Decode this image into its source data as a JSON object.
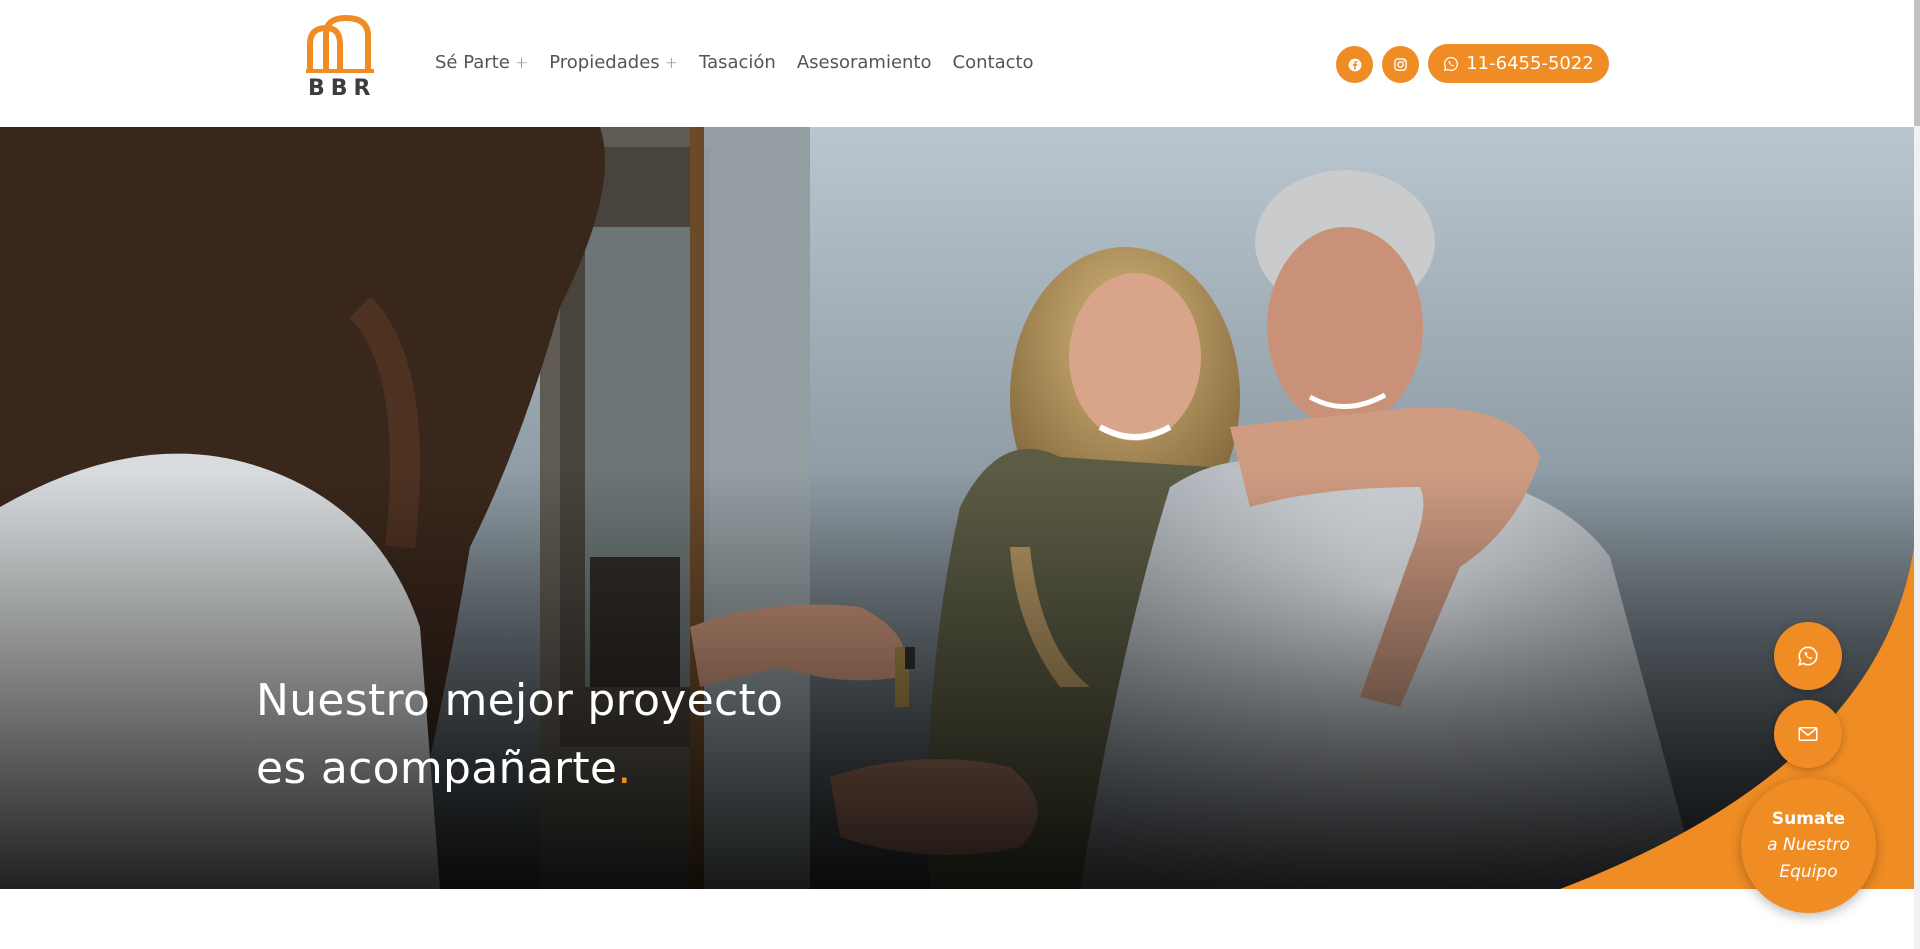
{
  "brand": {
    "name": "BBR",
    "accent_color": "#f08c24",
    "logo_icon": "arch-logo-icon"
  },
  "nav": {
    "items": [
      {
        "label": "Sé Parte",
        "has_submenu": true,
        "submenu_icon": "plus-icon"
      },
      {
        "label": "Propiedades",
        "has_submenu": true,
        "submenu_icon": "plus-icon"
      },
      {
        "label": "Tasación",
        "has_submenu": false
      },
      {
        "label": "Asesoramiento",
        "has_submenu": false
      },
      {
        "label": "Contacto",
        "has_submenu": false
      }
    ]
  },
  "header_actions": {
    "facebook_icon": "facebook-icon",
    "instagram_icon": "instagram-icon",
    "phone_icon": "whatsapp-icon",
    "phone": "11-6455-5022"
  },
  "hero": {
    "title_line1": "Nuestro mejor proyecto",
    "title_line2": "es acompañarte",
    "title_dot": ".",
    "image": "photo of a couple receiving house keys from a real estate agent"
  },
  "floating": {
    "whatsapp_icon": "whatsapp-icon",
    "email_icon": "envelope-icon",
    "cta_line1": "Sumate",
    "cta_line2": "a Nuestro",
    "cta_line3": "Equipo"
  }
}
